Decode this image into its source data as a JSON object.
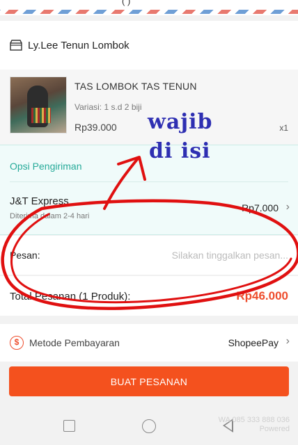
{
  "header": {
    "top_text": "(   )"
  },
  "shop": {
    "name": "Ly.Lee Tenun Lombok"
  },
  "product": {
    "title": "TAS LOMBOK TAS TENUN",
    "variant": "Variasi: 1 s.d 2 biji",
    "price": "Rp39.000",
    "quantity": "x1"
  },
  "shipping": {
    "section_title": "Opsi Pengiriman",
    "courier": "J&T Express",
    "eta": "Diterima dalam 2-4 hari",
    "price": "Rp7.000"
  },
  "message": {
    "label": "Pesan:",
    "placeholder": "Silakan tinggalkan pesan..."
  },
  "total": {
    "label": "Total Pesanan (1 Produk):",
    "value": "Rp46.000"
  },
  "payment": {
    "label": "Metode Pembayaran",
    "value": "ShopeePay"
  },
  "order_button": {
    "label": "BUAT PESANAN"
  },
  "annotation": {
    "line1": "wajib",
    "line2": "di isi",
    "color": "#2e2fb2",
    "mark_color": "#e01010"
  },
  "watermark": {
    "line1": "WA 085 333 888 036",
    "line2": "Powered"
  },
  "colors": {
    "accent": "#ee4d2d",
    "teal": "#26aa99"
  },
  "icons": [
    "shop-icon",
    "chevron-right-icon",
    "dollar-circle-icon",
    "recent-apps-icon",
    "home-icon",
    "back-icon"
  ]
}
